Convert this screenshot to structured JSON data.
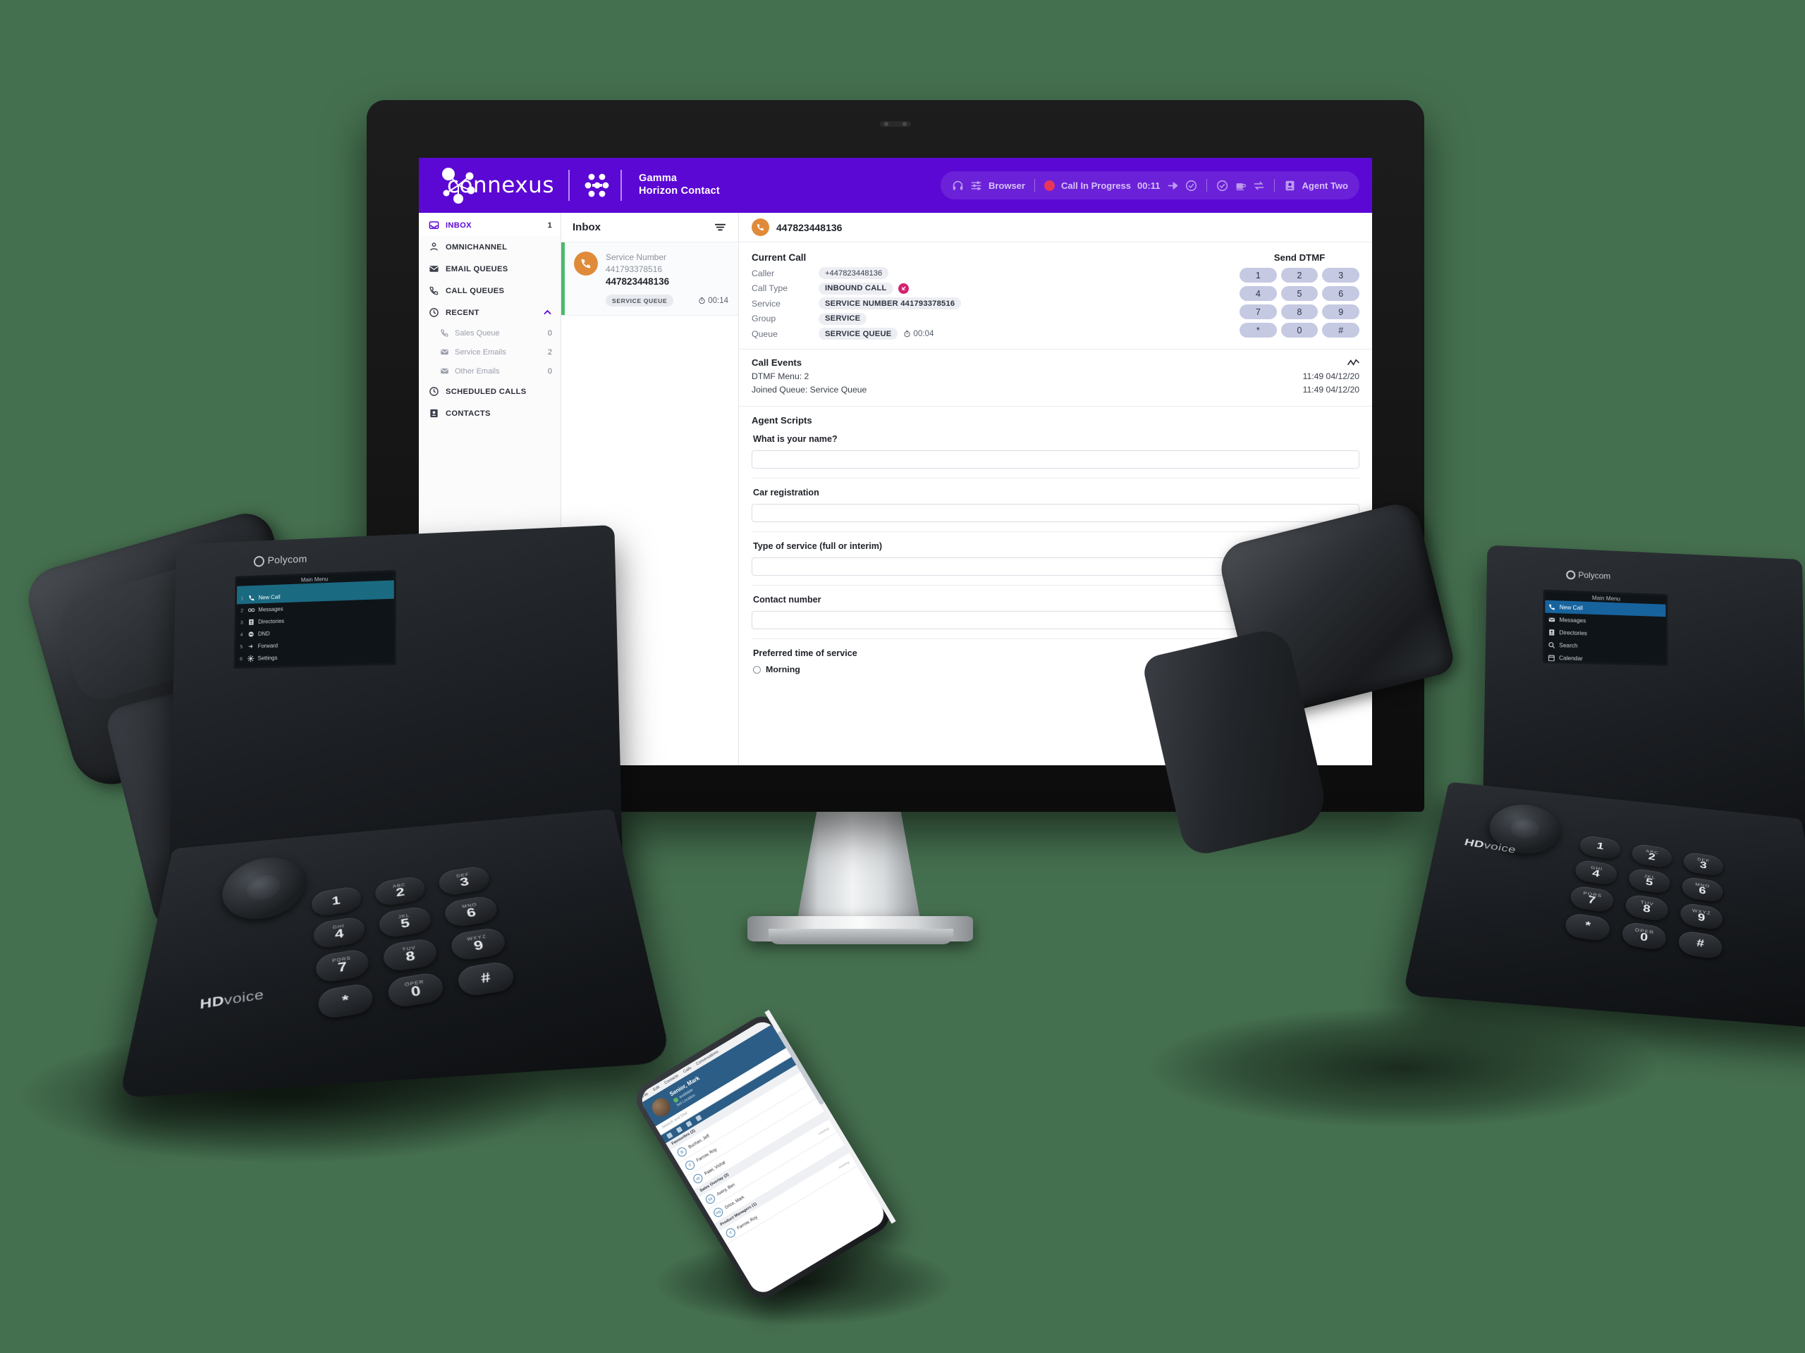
{
  "header": {
    "brand_word": "connexus",
    "product_line1": "Gamma",
    "product_line2": "Horizon Contact",
    "toolbar": {
      "browser_label": "Browser",
      "call_status": "Call In Progress",
      "call_timer": "00:11",
      "agent_name": "Agent Two"
    }
  },
  "sidebar": {
    "items": [
      {
        "label": "INBOX",
        "count": "1",
        "icon": "inbox-icon",
        "active": true
      },
      {
        "label": "OMNICHANNEL",
        "count": "",
        "icon": "omnichannel-icon",
        "active": false
      },
      {
        "label": "EMAIL QUEUES",
        "count": "",
        "icon": "email-icon",
        "active": false
      },
      {
        "label": "CALL QUEUES",
        "count": "",
        "icon": "phone-icon",
        "active": false
      },
      {
        "label": "RECENT",
        "count": "",
        "icon": "clock-icon",
        "active": false
      }
    ],
    "recent_children": [
      {
        "label": "Sales Queue",
        "count": "0",
        "icon": "phone-icon"
      },
      {
        "label": "Service Emails",
        "count": "2",
        "icon": "email-icon"
      },
      {
        "label": "Other Emails",
        "count": "0",
        "icon": "email-icon"
      }
    ],
    "items_after": [
      {
        "label": "SCHEDULED CALLS",
        "count": "",
        "icon": "clock-icon"
      },
      {
        "label": "CONTACTS",
        "count": "",
        "icon": "contacts-icon"
      }
    ]
  },
  "inbox": {
    "title": "Inbox",
    "card": {
      "service_label": "Service Number",
      "service_number": "441793378516",
      "caller_number": "447823448136",
      "queue_tag": "SERVICE QUEUE",
      "timer": "00:14"
    }
  },
  "detail": {
    "header_number": "447823448136",
    "current_call": {
      "title": "Current Call",
      "rows": [
        {
          "key": "Caller",
          "value": "+447823448136",
          "bold": false
        },
        {
          "key": "Call Type",
          "value": "INBOUND CALL",
          "bold": true
        },
        {
          "key": "Service",
          "value": "SERVICE NUMBER 441793378516",
          "bold": true
        },
        {
          "key": "Group",
          "value": "SERVICE",
          "bold": true
        },
        {
          "key": "Queue",
          "value": "SERVICE QUEUE",
          "bold": true
        }
      ],
      "queue_timer": "00:04"
    },
    "dtmf": {
      "title": "Send DTMF",
      "keys": [
        "1",
        "2",
        "3",
        "4",
        "5",
        "6",
        "7",
        "8",
        "9",
        "*",
        "0",
        "#"
      ]
    },
    "call_events": {
      "title": "Call Events",
      "rows": [
        {
          "text": "DTMF Menu: 2",
          "time": "11:49 04/12/20"
        },
        {
          "text": "Joined Queue: Service Queue",
          "time": "11:49 04/12/20"
        }
      ]
    },
    "agent_scripts": {
      "title": "Agent Scripts",
      "fields": [
        {
          "label": "What is your name?",
          "value": "",
          "type": "text"
        },
        {
          "label": "Car registration",
          "value": "",
          "type": "text"
        },
        {
          "label": "Type of service (full or interim)",
          "value": "",
          "type": "text"
        },
        {
          "label": "Contact number",
          "value": "",
          "type": "text"
        }
      ],
      "radio_group": {
        "label": "Preferred time of service",
        "options": [
          "Morning"
        ]
      }
    }
  },
  "phone_left": {
    "brand": "Polycom",
    "hd_voice_bold": "HD",
    "hd_voice_light": "voice",
    "screen_title": "Main Menu",
    "menu": [
      {
        "num": "1",
        "label": "New Call",
        "icon": "phone-icon",
        "selected": true
      },
      {
        "num": "2",
        "label": "Messages",
        "icon": "voicemail-icon",
        "selected": false
      },
      {
        "num": "3",
        "label": "Directories",
        "icon": "directory-icon",
        "selected": false
      },
      {
        "num": "4",
        "label": "DND",
        "icon": "dnd-icon",
        "selected": false
      },
      {
        "num": "5",
        "label": "Forward",
        "icon": "forward-icon",
        "selected": false
      },
      {
        "num": "6",
        "label": "Settings",
        "icon": "settings-icon",
        "selected": false
      }
    ],
    "keypad": [
      {
        "d": "1",
        "l": ""
      },
      {
        "d": "2",
        "l": "ABC"
      },
      {
        "d": "3",
        "l": "DEF"
      },
      {
        "d": "4",
        "l": "GHI"
      },
      {
        "d": "5",
        "l": "JKL"
      },
      {
        "d": "6",
        "l": "MNO"
      },
      {
        "d": "7",
        "l": "PQRS"
      },
      {
        "d": "8",
        "l": "TUV"
      },
      {
        "d": "9",
        "l": "WXYZ"
      },
      {
        "d": "*",
        "l": ""
      },
      {
        "d": "0",
        "l": "OPER"
      },
      {
        "d": "#",
        "l": ""
      }
    ]
  },
  "phone_right": {
    "brand": "Polycom",
    "hd_voice_bold": "HD",
    "hd_voice_light": "voice",
    "screen_title": "Main Menu",
    "menu": [
      {
        "label": "New Call",
        "icon": "phone-icon",
        "selected": true
      },
      {
        "label": "Messages",
        "icon": "voicemail-icon",
        "selected": false
      },
      {
        "label": "Directories",
        "icon": "directory-icon",
        "selected": false
      },
      {
        "label": "Search",
        "icon": "search-icon",
        "selected": false
      },
      {
        "label": "Calendar",
        "icon": "calendar-icon",
        "selected": false
      }
    ],
    "keypad": [
      {
        "d": "1",
        "l": ""
      },
      {
        "d": "2",
        "l": "ABC"
      },
      {
        "d": "3",
        "l": "DEF"
      },
      {
        "d": "4",
        "l": "GHI"
      },
      {
        "d": "5",
        "l": "JKL"
      },
      {
        "d": "6",
        "l": "MNO"
      },
      {
        "d": "7",
        "l": "PQRS"
      },
      {
        "d": "8",
        "l": "TUV"
      },
      {
        "d": "9",
        "l": "WXYZ"
      },
      {
        "d": "*",
        "l": ""
      },
      {
        "d": "0",
        "l": "OPER"
      },
      {
        "d": "#",
        "l": ""
      }
    ]
  },
  "mobile": {
    "menus": [
      "File",
      "Edit",
      "Contacts",
      "Calls",
      "Conversations"
    ],
    "profile_name": "Senior, Mark",
    "presence": "available",
    "location": "Set Location",
    "search_placeholder": "Search and Dial",
    "groups": [
      {
        "name": "Favourites (2)",
        "rows": [
          {
            "initials": "jb",
            "name": "Buchan, Jeff",
            "sub": ""
          },
          {
            "initials": "rf",
            "name": "Farrow, Roy",
            "sub": ""
          },
          {
            "initials": "vp",
            "name": "Patel, Vishal",
            "sub": ""
          }
        ]
      },
      {
        "name": "Sales Overlay (2)",
        "rows": [
          {
            "initials": "ba",
            "name": "Avery, Ben",
            "sub": "meeting"
          },
          {
            "initials": "mg",
            "name": "Grice, Mark",
            "sub": ""
          }
        ]
      },
      {
        "name": "Product Managers (1)",
        "rows": [
          {
            "initials": "rf",
            "name": "Farrow, Roy",
            "sub": "meeting"
          }
        ]
      }
    ]
  },
  "colors": {
    "background": "#45704f",
    "brand_purple": "#5B08D4",
    "accent_green": "#4cb96b",
    "avatar_orange": "#e08b3a",
    "badge_pink": "#d6226e",
    "status_red": "#e8365a",
    "dtmf_key": "#c5c9e2",
    "phone_screen_highlight": "#1a6a82"
  }
}
